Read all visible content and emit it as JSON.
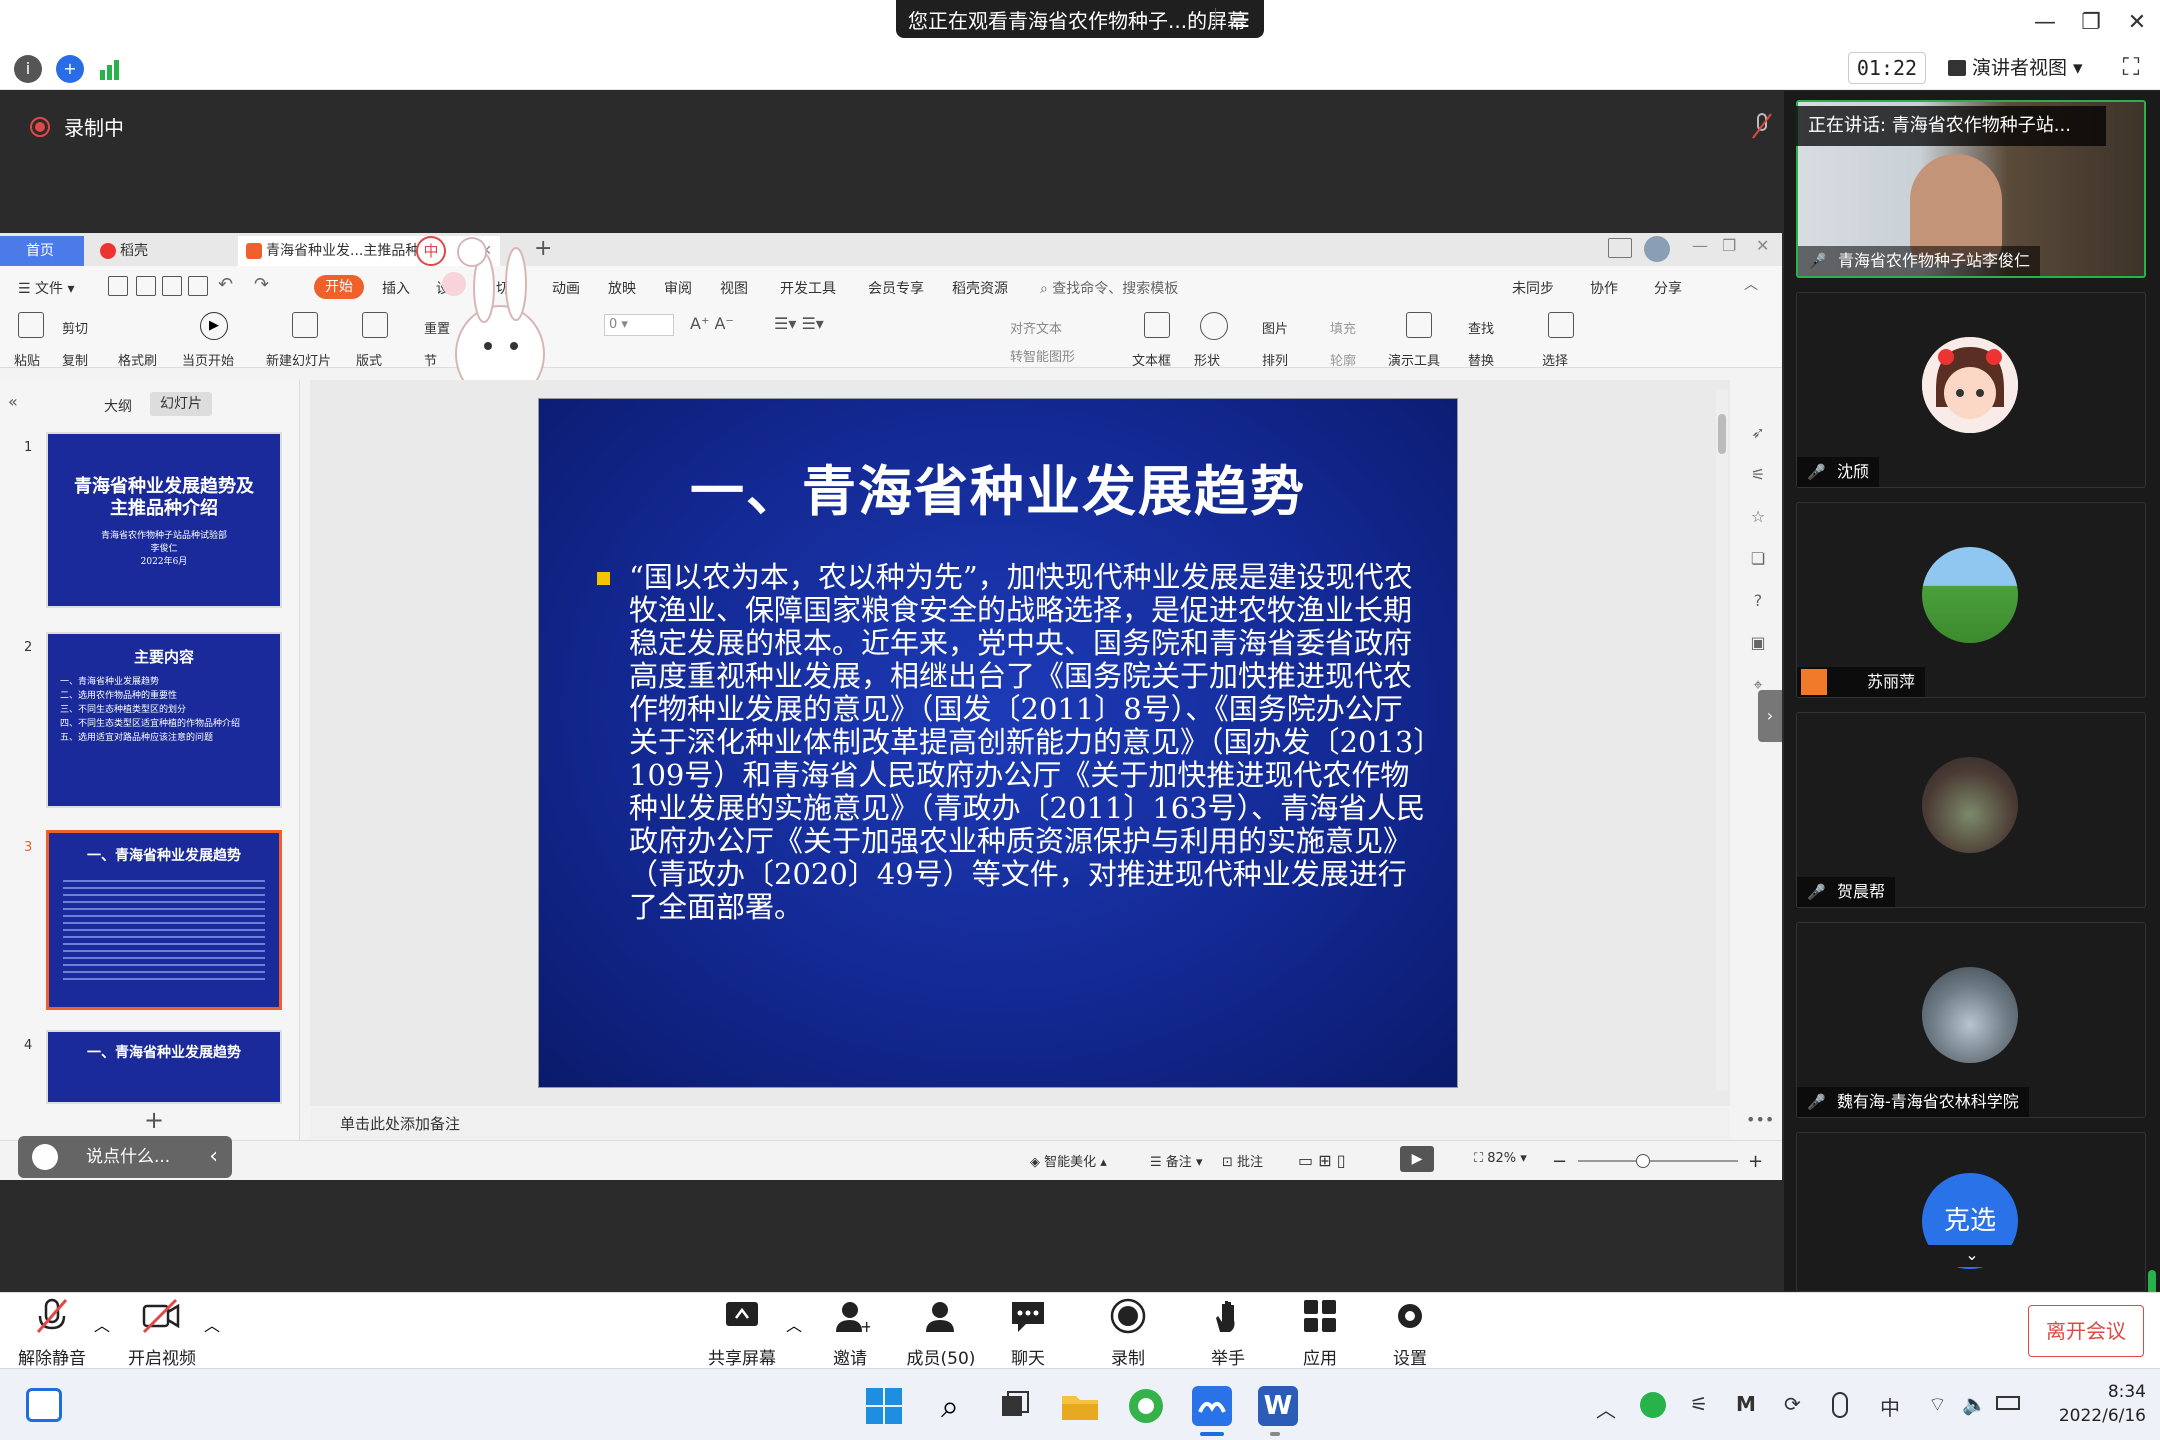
{
  "window": {
    "share_banner": "您正在观看青海省农作物种子...的屏幕",
    "timer": "01:22",
    "presenter_view": "演讲者视图",
    "recording": "录制中"
  },
  "speaking": "正在讲话: 青海省农作物种子站...",
  "wps": {
    "tabs": [
      "首页",
      "稻壳",
      "青海省种业发...主推品种"
    ],
    "menu": [
      "文件",
      "开始",
      "插入",
      "设计",
      "切换",
      "动画",
      "放映",
      "审阅",
      "视图",
      "开发工具",
      "会员专享",
      "稻壳资源"
    ],
    "search": "查找命令、搜索模板",
    "menu_right": [
      "未同步",
      "协作",
      "分享"
    ],
    "ribbon": [
      "粘贴",
      "剪切",
      "复制",
      "格式刷",
      "当页开始",
      "新建幻灯片",
      "版式",
      "重置",
      "节",
      "文本框",
      "形状",
      "图片",
      "排列",
      "填充",
      "轮廓",
      "演示工具",
      "查找",
      "替换",
      "选择",
      "对齐文本",
      "转智能图形"
    ],
    "panel_tabs": [
      "大纲",
      "幻灯片"
    ],
    "thumbs": [
      {
        "num": "1",
        "title": "青海省种业发展趋势及主推品种介绍",
        "sub": "青海省农作物种子站品种试验部",
        "author": "李俊仁",
        "date": "2022年6月"
      },
      {
        "num": "2",
        "title": "主要内容",
        "items": [
          "一、青海省种业发展趋势",
          "二、选用农作物品种的重要性",
          "三、不同生态种植类型区的划分",
          "四、不同生态类型区适宜种植的作物品种介绍",
          "五、选用适宜对路品种应该注意的问题"
        ]
      },
      {
        "num": "3",
        "title": "一、青海省种业发展趋势"
      },
      {
        "num": "4",
        "title": "一、青海省种业发展趋势"
      }
    ],
    "slide": {
      "title": "一、青海省种业发展趋势",
      "body": "“国以农为本，农以种为先”，加快现代种业发展是建设现代农牧渔业、保障国家粮食安全的战略选择，是促进农牧渔业长期稳定发展的根本。近年来，党中央、国务院和青海省委省政府高度重视种业发展，相继出台了《国务院关于加快推进现代农作物种业发展的意见》（国发〔2011〕8号）、《国务院办公厅关于深化种业体制改革提高创新能力的意见》（国办发〔2013〕109号）和青海省人民政府办公厅《关于加快推进现代农作物种业发展的实施意见》（青政办〔2011〕163号）、青海省人民政府办公厅《关于加强农业种质资源保护与利用的实施意见》（青政办〔2020〕49号）等文件，对推进现代种业发展进行了全面部署。"
    },
    "notes": "单击此处添加备注",
    "status": [
      "智能美化",
      "备注",
      "批注",
      "82%"
    ],
    "chat_placeholder": "说点什么..."
  },
  "participants": [
    {
      "name": "青海省农作物种子站李俊仁"
    },
    {
      "name": "沈颀"
    },
    {
      "name": "苏丽萍"
    },
    {
      "name": "贺晨帮"
    },
    {
      "name": "魏有海-青海省农林科学院"
    },
    {
      "name": "克选"
    }
  ],
  "controls": {
    "left": [
      "解除静音",
      "开启视频"
    ],
    "center": [
      "共享屏幕",
      "邀请",
      "成员(50)",
      "聊天",
      "录制",
      "举手",
      "应用",
      "设置"
    ],
    "leave": "离开会议"
  },
  "clock": {
    "time": "8:34",
    "date": "2022/6/16"
  }
}
